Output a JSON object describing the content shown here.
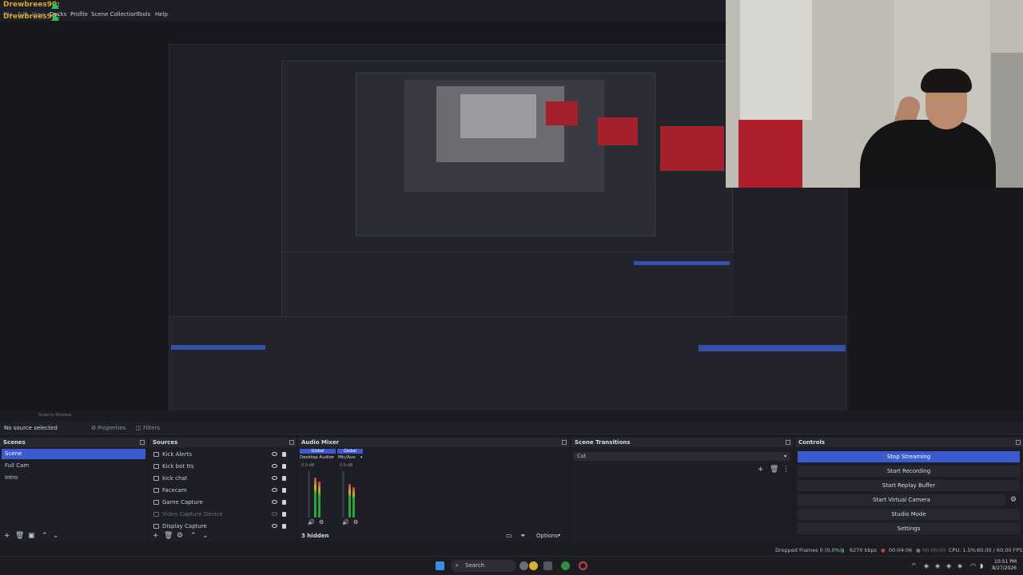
{
  "overlay": {
    "username": "Drewbrees90:"
  },
  "menubar": {
    "items": [
      "File",
      "Edit",
      "View",
      "Docks",
      "Profile",
      "Scene Collection",
      "Tools",
      "Help"
    ]
  },
  "topbar": {
    "zoom": "Scale to Window"
  },
  "props_bar": {
    "no_source": "No source selected",
    "properties": "Properties",
    "filters": "Filters"
  },
  "scenes": {
    "title": "Scenes",
    "items": [
      "Scene",
      "Full Cam",
      "Intro"
    ],
    "active_index": 0
  },
  "sources": {
    "title": "Sources",
    "items": [
      {
        "label": "Kick Alerts",
        "dim": false
      },
      {
        "label": "Kick bot tts",
        "dim": false
      },
      {
        "label": "kick chat",
        "dim": false
      },
      {
        "label": "Facecam",
        "dim": false
      },
      {
        "label": "Game Capture",
        "dim": false
      },
      {
        "label": "Video Capture Device",
        "dim": true
      },
      {
        "label": "Display Capture",
        "dim": false
      }
    ]
  },
  "audio_mixer": {
    "title": "Audio Mixer",
    "channels": [
      {
        "global": "Global",
        "name": "Desktop Audio",
        "db": "0.0 dB"
      },
      {
        "global": "Global",
        "name": "Mic/Aux",
        "db": "0.0 dB"
      }
    ],
    "hidden": "3 hidden",
    "options": "Options"
  },
  "scene_transitions": {
    "title": "Scene Transitions",
    "selected": "Cut"
  },
  "controls": {
    "title": "Controls",
    "buttons": [
      "Stop Streaming",
      "Start Recording",
      "Start Replay Buffer",
      "Start Virtual Camera",
      "Studio Mode",
      "Settings"
    ]
  },
  "statusbar": {
    "dropped": "Dropped Frames 0 (0.0%)",
    "bitrate": "6270 kbps",
    "live_time": "00:04:06",
    "rec_time": "00:00:00",
    "cpu": "CPU: 1.5%",
    "fps": "60.00 / 60.00 FPS"
  },
  "taskbar": {
    "search": "Search",
    "time": "10:51 PM",
    "date": "8/27/2026"
  },
  "colors": {
    "accent": "#3d5bd1",
    "kick_green": "#25c46b",
    "overlay_name": "#d4a82a"
  }
}
